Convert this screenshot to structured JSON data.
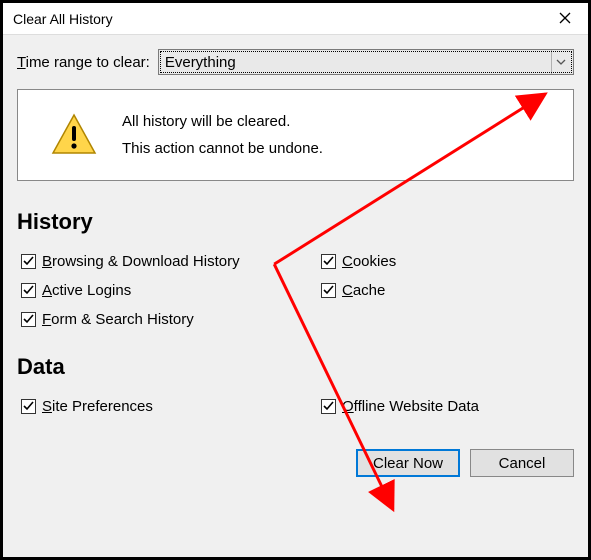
{
  "window": {
    "title": "Clear All History"
  },
  "timerange": {
    "label_pre": "T",
    "label_rest": "ime range to clear:",
    "value": "Everything"
  },
  "warning": {
    "line1": "All history will be cleared.",
    "line2": "This action cannot be undone."
  },
  "sections": {
    "history": {
      "heading": "History"
    },
    "data": {
      "heading": "Data"
    }
  },
  "checks": {
    "browsing": {
      "u": "B",
      "rest": "rowsing & Download History",
      "checked": true
    },
    "cookies": {
      "u": "C",
      "rest": "ookies",
      "checked": true
    },
    "active": {
      "u": "A",
      "rest": "ctive Logins",
      "checked": true
    },
    "cache": {
      "u": "C",
      "rest": "ache",
      "checked": true
    },
    "form": {
      "u": "F",
      "rest": "orm & Search History",
      "checked": true
    },
    "site": {
      "u": "S",
      "rest": "ite Preferences",
      "checked": true
    },
    "offline": {
      "u": "O",
      "rest": "ffline Website Data",
      "checked": true
    }
  },
  "buttons": {
    "clear": "Clear Now",
    "cancel": "Cancel"
  },
  "colors": {
    "accent": "#0078d7",
    "arrow": "#ff0000",
    "warn_yellow": "#ffd54a"
  }
}
